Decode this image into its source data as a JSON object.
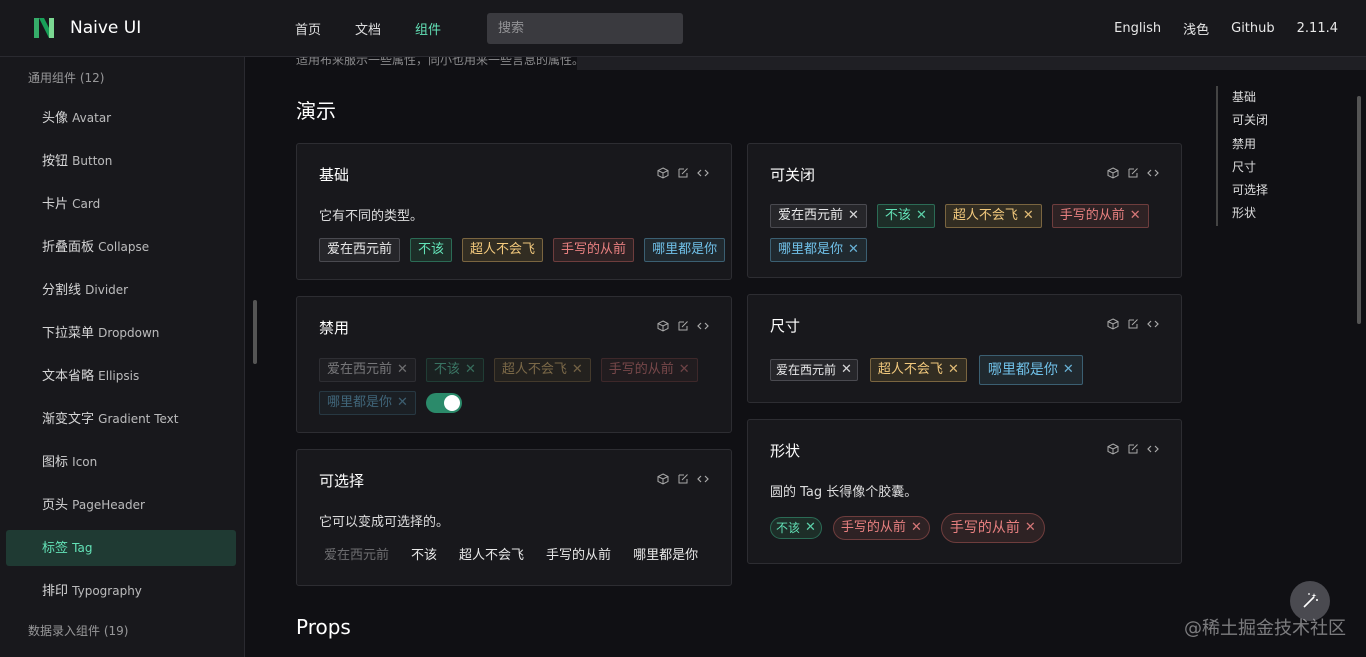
{
  "header": {
    "app_name": "Naive UI",
    "nav": [
      "首页",
      "文档",
      "组件"
    ],
    "search_placeholder": "搜索",
    "right": [
      "English",
      "浅色",
      "Github",
      "2.11.4"
    ],
    "accent_color": "#63e2b7"
  },
  "sidebar": {
    "group1_title": "通用组件 (12)",
    "items": [
      {
        "zh": "头像",
        "en": "Avatar"
      },
      {
        "zh": "按钮",
        "en": "Button"
      },
      {
        "zh": "卡片",
        "en": "Card"
      },
      {
        "zh": "折叠面板",
        "en": "Collapse"
      },
      {
        "zh": "分割线",
        "en": "Divider"
      },
      {
        "zh": "下拉菜单",
        "en": "Dropdown"
      },
      {
        "zh": "文本省略",
        "en": "Ellipsis"
      },
      {
        "zh": "渐变文字",
        "en": "Gradient Text"
      },
      {
        "zh": "图标",
        "en": "Icon"
      },
      {
        "zh": "页头",
        "en": "PageHeader"
      },
      {
        "zh": "标签",
        "en": "Tag"
      },
      {
        "zh": "排印",
        "en": "Typography"
      }
    ],
    "active_item": "Tag",
    "group2_title": "数据录入组件 (19)"
  },
  "main": {
    "cut_text": "适用布来服示一些属性，同小也用来一些言息的属性。",
    "demo_title": "演示",
    "props_title": "Props",
    "cards": {
      "basic": {
        "title": "基础",
        "desc": "它有不同的类型。",
        "tags": [
          "爱在西元前",
          "不该",
          "超人不会飞",
          "手写的从前",
          "哪里都是你"
        ]
      },
      "closable": {
        "title": "可关闭",
        "tags": [
          "爱在西元前",
          "不该",
          "超人不会飞",
          "手写的从前",
          "哪里都是你"
        ]
      },
      "disabled": {
        "title": "禁用",
        "tags": [
          "爱在西元前",
          "不该",
          "超人不会飞",
          "手写的从前",
          "哪里都是你"
        ],
        "switch_on": true
      },
      "size": {
        "title": "尺寸",
        "tags": [
          "爱在西元前",
          "超人不会飞",
          "哪里都是你"
        ]
      },
      "checkable": {
        "title": "可选择",
        "desc": "它可以变成可选择的。",
        "tags": [
          "爱在西元前",
          "不该",
          "超人不会飞",
          "手写的从前",
          "哪里都是你"
        ]
      },
      "shape": {
        "title": "形状",
        "desc": "圆的 Tag 长得像个胶囊。",
        "tags": [
          "不该",
          "手写的从前",
          "手写的从前"
        ]
      }
    },
    "anchor": [
      "基础",
      "可关闭",
      "禁用",
      "尺寸",
      "可选择",
      "形状"
    ]
  },
  "watermark": "@稀土掘金技术社区",
  "icons": [
    "cube-icon",
    "edit-icon",
    "code-icon",
    "magic-wand-icon"
  ]
}
